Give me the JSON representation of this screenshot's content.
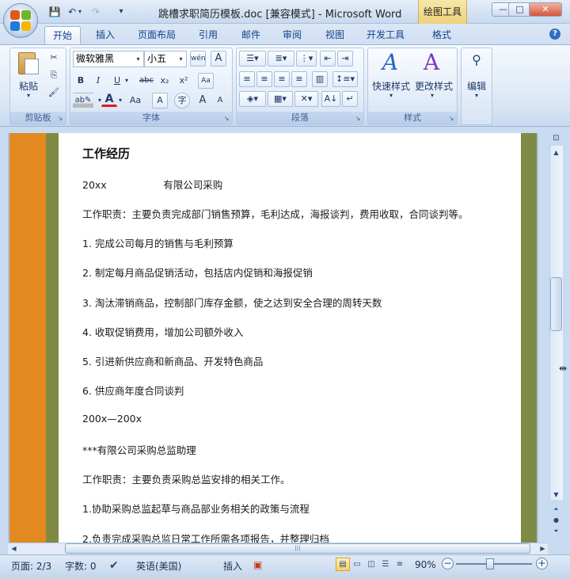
{
  "window": {
    "title": "跳槽求职简历模板.doc [兼容模式] - Microsoft Word",
    "context_tab": "绘图工具"
  },
  "window_buttons": {
    "minimize": "—",
    "maximize": "□",
    "close": "✕"
  },
  "quick_access": {
    "save": "💾",
    "undo": "↶",
    "redo": "↷",
    "customize": "▾"
  },
  "tabs": [
    {
      "label": "开始",
      "active": true
    },
    {
      "label": "插入"
    },
    {
      "label": "页面布局"
    },
    {
      "label": "引用"
    },
    {
      "label": "邮件"
    },
    {
      "label": "审阅"
    },
    {
      "label": "视图"
    },
    {
      "label": "开发工具"
    },
    {
      "label": "格式"
    }
  ],
  "help": "?",
  "ribbon": {
    "clipboard": {
      "group_label": "剪贴板",
      "paste": "粘贴"
    },
    "font": {
      "group_label": "字体",
      "font_name": "微软雅黑",
      "font_size": "小五",
      "bold": "B",
      "italic": "I",
      "underline": "U",
      "strike": "abc",
      "subscript": "x₂",
      "superscript": "x²",
      "grow": "A",
      "shrink": "A",
      "case": "Aa",
      "clear": "A",
      "phonetic": "wén",
      "border": "A",
      "circle": "字"
    },
    "paragraph": {
      "group_label": "段落"
    },
    "styles": {
      "group_label": "样式",
      "quick_styles": "快速样式",
      "change_styles": "更改样式"
    },
    "editing": {
      "label": "编辑"
    }
  },
  "document": {
    "heading": "工作经历",
    "lines": [
      "20xx                  有限公司采购",
      "工作职责：主要负责完成部门销售预算，毛利达成，海报谈判，费用收取，合同谈判等。",
      "1. 完成公司每月的销售与毛利预算",
      "2. 制定每月商品促销活动，包括店内促销和海报促销",
      "3. 淘汰滞销商品，控制部门库存金额，使之达到安全合理的周转天数",
      "4. 收取促销费用，增加公司额外收入",
      "5. 引进新供应商和新商品、开发特色商品",
      "6. 供应商年度合同谈判",
      "200x—200x",
      "***有限公司采购总监助理",
      "工作职责：主要负责采购总监安排的相关工作。",
      "1.协助采购总监起草与商品部业务相关的政策与流程",
      "2.负责完成采购总监日常工作所需各项报告，并整理归档"
    ]
  },
  "status": {
    "page": "页面: 2/3",
    "words": "字数: 0",
    "language": "英语(美国)",
    "mode": "插入",
    "zoom": "90%"
  },
  "colors": {
    "orange_bar": "#e28a1f",
    "olive_bar": "#7f8a45",
    "ribbon_text": "#15428b"
  }
}
